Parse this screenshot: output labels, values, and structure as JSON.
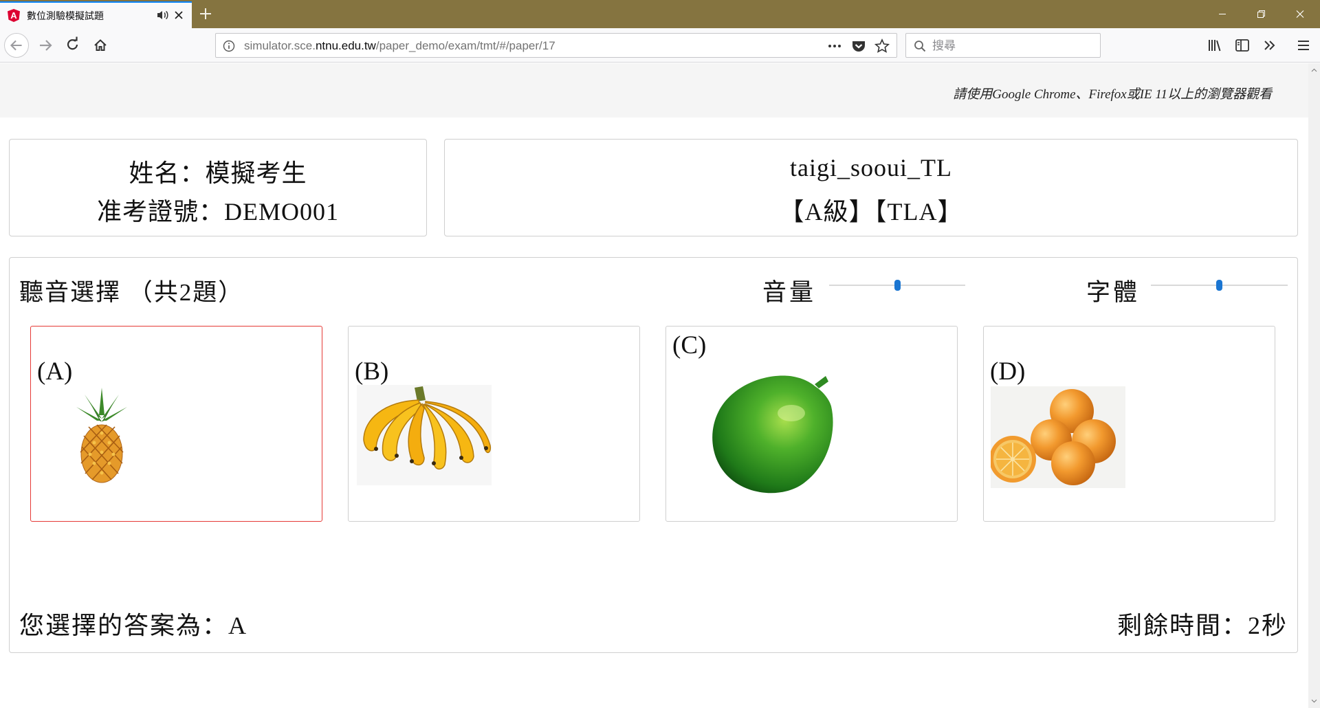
{
  "browser": {
    "tab_title": "數位測驗模擬試題",
    "url_prefix": "simulator.sce.",
    "url_domain": "ntnu.edu.tw",
    "url_path": "/paper_demo/exam/tmt/#/paper/17",
    "search_placeholder": "搜尋",
    "accent_color": "#857440"
  },
  "page": {
    "browser_notice": "請使用Google  Chrome、Firefox或IE  11以上的瀏覽器觀看",
    "candidate": {
      "name_line": "姓名：模擬考生",
      "id_line": "准考證號：DEMO001"
    },
    "exam": {
      "code": "taigi_sooui_TL",
      "level_line": "【A級】【TLA】"
    },
    "question": {
      "title": "聽音選擇 （共2題）",
      "volume_label": "音量",
      "volume_level": 0.5,
      "font_label": "字體",
      "font_level": 0.5,
      "options": [
        {
          "label": "(A)",
          "image": "pineapple",
          "selected": true
        },
        {
          "label": "(B)",
          "image": "banana",
          "selected": false
        },
        {
          "label": "(C)",
          "image": "lime",
          "selected": false
        },
        {
          "label": "(D)",
          "image": "orange",
          "selected": false
        }
      ],
      "answer_line": "您選擇的答案為：A",
      "time_line": "剩餘時間：2秒"
    }
  },
  "colors": {
    "selected_border": "#e53935",
    "slider_thumb": "#1b76d2"
  }
}
